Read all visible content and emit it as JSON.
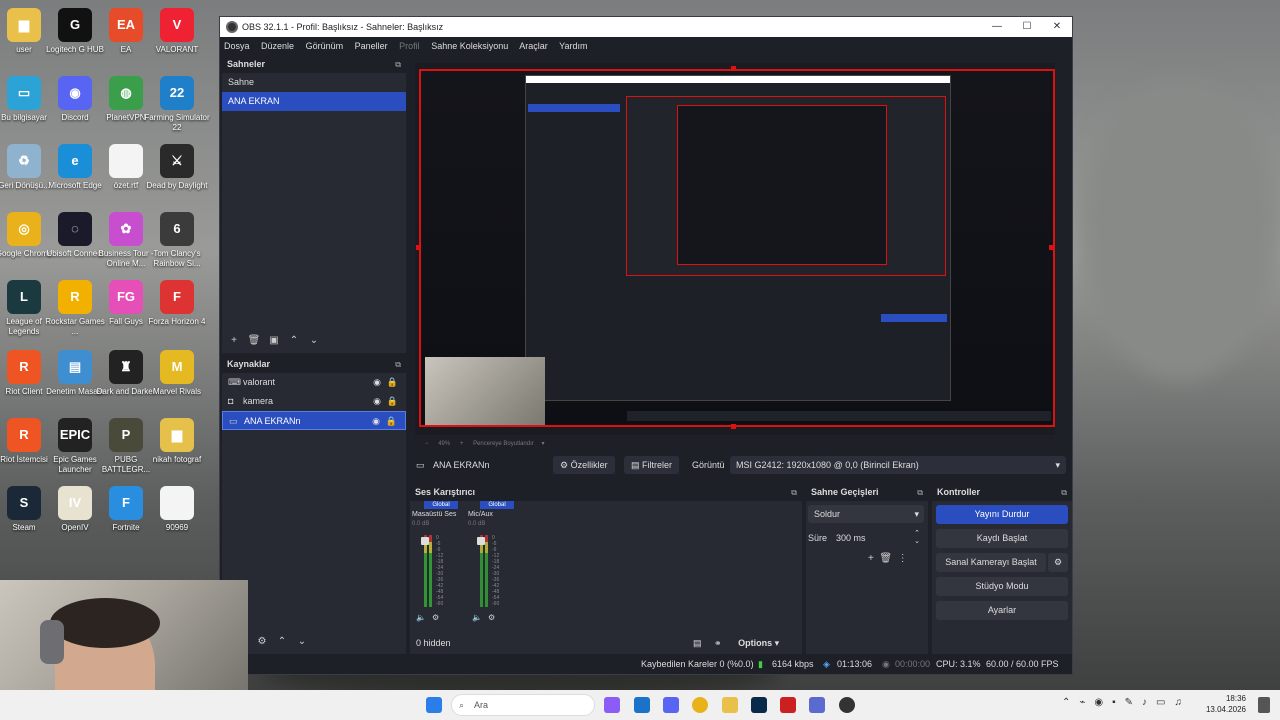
{
  "desktop": {
    "icons": [
      {
        "label": "user",
        "name": "user-folder",
        "color": "#e8c04a",
        "glyph": "▆"
      },
      {
        "label": "Logitech G HUB",
        "name": "logitech-g-hub",
        "color": "#111",
        "glyph": "G"
      },
      {
        "label": "EA",
        "name": "ea",
        "color": "#e74c2a",
        "glyph": "EA"
      },
      {
        "label": "VALORANT",
        "name": "valorant",
        "color": "#e23",
        "glyph": "V"
      },
      {
        "label": "Bu bilgisayar",
        "name": "this-pc",
        "color": "#2ba3d6",
        "glyph": "▭"
      },
      {
        "label": "Discord",
        "name": "discord",
        "color": "#5865f2",
        "glyph": "◉"
      },
      {
        "label": "PlanetVPN",
        "name": "planetvpn",
        "color": "#3a9e4b",
        "glyph": "◍"
      },
      {
        "label": "Farming Simulator 22",
        "name": "farming-simulator",
        "color": "#1f7fc8",
        "glyph": "22"
      },
      {
        "label": "Geri Dönüşü...",
        "name": "recycle-bin",
        "color": "#8fb3cf",
        "glyph": "♻"
      },
      {
        "label": "Microsoft Edge",
        "name": "edge",
        "color": "#1a8fd8",
        "glyph": "e"
      },
      {
        "label": "özet.rtf",
        "name": "ozet-rtf",
        "color": "#f4f4f4",
        "glyph": ""
      },
      {
        "label": "Dead by Daylight",
        "name": "dead-by-daylight",
        "color": "#2a2a2a",
        "glyph": "⚔"
      },
      {
        "label": "Google Chrome",
        "name": "chrome",
        "color": "#e9b11a",
        "glyph": "◎"
      },
      {
        "label": "Ubisoft Connect",
        "name": "ubisoft",
        "color": "#1a1a2a",
        "glyph": "◌"
      },
      {
        "label": "Business Tour - Online M...",
        "name": "business-tour",
        "color": "#c74fcf",
        "glyph": "✿"
      },
      {
        "label": "Tom Clancy's Rainbow Si...",
        "name": "rainbow-six",
        "color": "#3b3b3b",
        "glyph": "6"
      },
      {
        "label": "League of Legends",
        "name": "league-of-legends",
        "color": "#1a3a40",
        "glyph": "L"
      },
      {
        "label": "Rockstar Games ...",
        "name": "rockstar",
        "color": "#f2b100",
        "glyph": "R"
      },
      {
        "label": "Fall Guys",
        "name": "fall-guys",
        "color": "#e54fb7",
        "glyph": "FG"
      },
      {
        "label": "Forza Horizon 4",
        "name": "forza-horizon",
        "color": "#d33",
        "glyph": "F"
      },
      {
        "label": "Riot Client",
        "name": "riot-client",
        "color": "#e52",
        "glyph": "R"
      },
      {
        "label": "Denetim Masası",
        "name": "control-panel",
        "color": "#3f8fd0",
        "glyph": "▤"
      },
      {
        "label": "Dark and Darker",
        "name": "dark-and-darker",
        "color": "#222",
        "glyph": "♜"
      },
      {
        "label": "Marvel Rivals",
        "name": "marvel-rivals",
        "color": "#e5b922",
        "glyph": "M"
      },
      {
        "label": "Riot İstemcisi",
        "name": "riot-istemcisi",
        "color": "#e52",
        "glyph": "R"
      },
      {
        "label": "Epic Games Launcher",
        "name": "epic-games",
        "color": "#222",
        "glyph": "EPIC"
      },
      {
        "label": "PUBG BATTLEGR...",
        "name": "pubg",
        "color": "#4a4a3a",
        "glyph": "P"
      },
      {
        "label": "nikah fotograf",
        "name": "nikah-fotograf",
        "color": "#e5c04a",
        "glyph": "▆"
      },
      {
        "label": "Steam",
        "name": "steam",
        "color": "#1b2838",
        "glyph": "S"
      },
      {
        "label": "OpenIV",
        "name": "openiv",
        "color": "#e8e2d0",
        "glyph": "IV"
      },
      {
        "label": "Fortnite",
        "name": "fortnite",
        "color": "#2a8ee0",
        "glyph": "F"
      },
      {
        "label": "90969",
        "name": "file-90969",
        "color": "#f4f4f4",
        "glyph": ""
      }
    ]
  },
  "obs": {
    "title": "OBS 32.1.1 - Profil: Başlıksız - Sahneler: Başlıksız",
    "menu": [
      "Dosya",
      "Düzenle",
      "Görünüm",
      "Paneller",
      "Profil",
      "Sahne Koleksiyonu",
      "Araçlar",
      "Yardım"
    ],
    "scenes": {
      "title": "Sahneler",
      "items": [
        "Sahne",
        "ANA EKRAN"
      ],
      "selected": 1
    },
    "sources": {
      "title": "Kaynaklar",
      "items": [
        {
          "label": "valorant",
          "icon": "gamepad-icon"
        },
        {
          "label": "kamera",
          "icon": "camera-icon"
        },
        {
          "label": "ANA EKRANn",
          "icon": "monitor-icon"
        }
      ],
      "selected": 2
    },
    "scale_text": "Pencereye Boyutlandır",
    "zoom_text": "49%",
    "source_bar": {
      "name": "ANA EKRANn",
      "properties": "Özellikler",
      "filters": "Filtreler",
      "display_label": "Görüntü",
      "display_value": "MSI G2412: 1920x1080 @ 0,0 (Birincil Ekran)"
    },
    "mixer": {
      "title": "Ses Karıştırıcı",
      "channels": [
        {
          "badge": "Global",
          "name": "Masaüstü Ses",
          "db": "0.0 dB",
          "level": 0.85
        },
        {
          "badge": "Global",
          "name": "Mic/Aux",
          "db": "0.0 dB",
          "level": 0.8
        }
      ],
      "ticks": [
        "0",
        "-5",
        "-9",
        "-12",
        "-18",
        "-24",
        "-30",
        "-36",
        "-42",
        "-48",
        "-54",
        "-60"
      ],
      "hidden_text": "0 hidden",
      "options": "Options"
    },
    "transitions": {
      "title": "Sahne Geçişleri",
      "type": "Soldur",
      "duration_label": "Süre",
      "duration_value": "300 ms"
    },
    "controls": {
      "title": "Kontroller",
      "buttons": [
        "Yayını Durdur",
        "Kaydı Başlat",
        "Sanal Kamerayı Başlat",
        "Stüdyo Modu",
        "Ayarlar"
      ]
    },
    "status": {
      "dropped": "Kaybedilen Kareler 0 (%0.0)",
      "bitrate": "6164 kbps",
      "stream_time": "01:13:06",
      "rec_time": "00:00:00",
      "cpu": "CPU: 3.1%",
      "fps": "60.00 / 60.00 FPS"
    },
    "colors": {
      "accent": "#2a4ec0",
      "preview_border": "#dd1111"
    }
  },
  "taskbar": {
    "search_placeholder": "Ara",
    "time": "18:36",
    "date": "13.04.2026"
  }
}
